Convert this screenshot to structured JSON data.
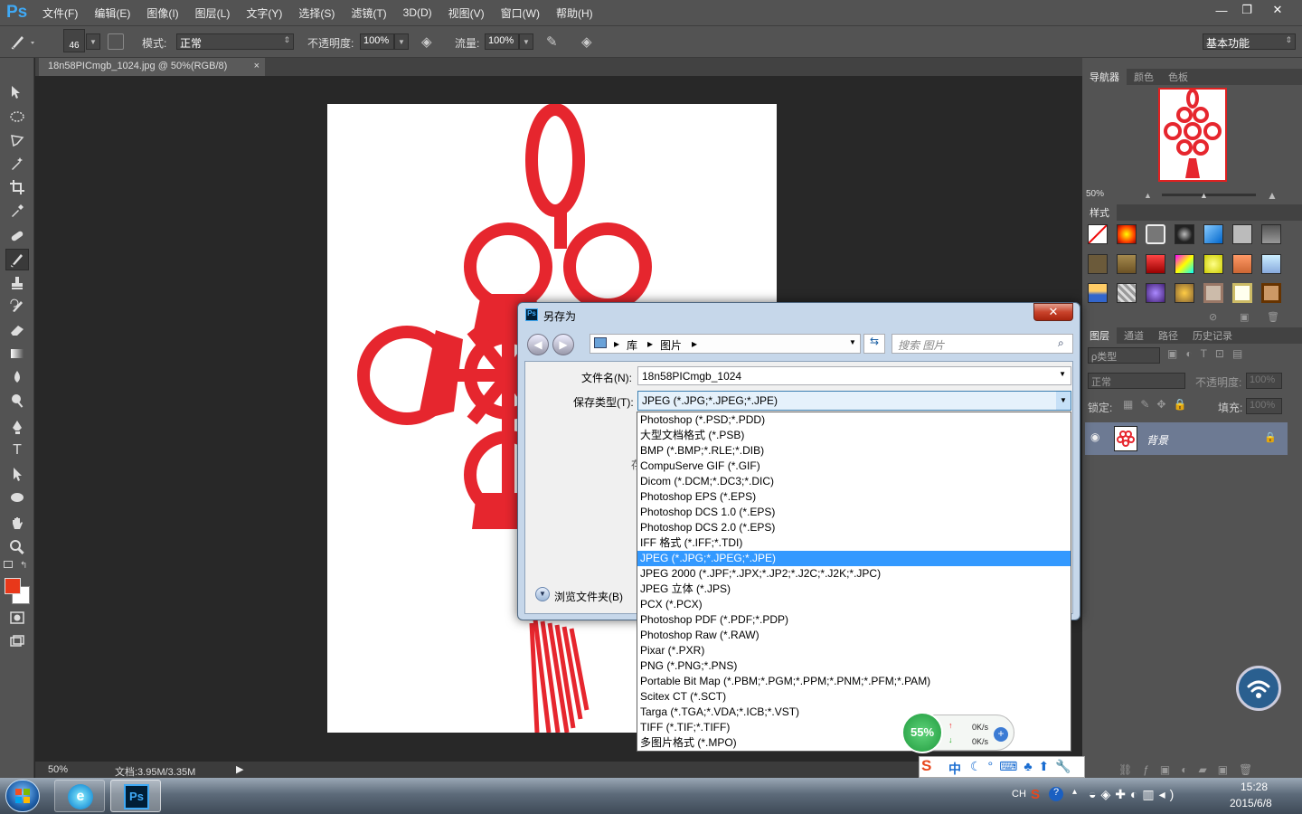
{
  "app": {
    "logo": "Ps",
    "menus": [
      "文件(F)",
      "编辑(E)",
      "图像(I)",
      "图层(L)",
      "文字(Y)",
      "选择(S)",
      "滤镜(T)",
      "3D(D)",
      "视图(V)",
      "窗口(W)",
      "帮助(H)"
    ],
    "window_buttons": [
      "—",
      "❐",
      "✕"
    ]
  },
  "options": {
    "brush_size": "46",
    "mode_label": "模式:",
    "mode_value": "正常",
    "opacity_label": "不透明度:",
    "opacity_value": "100%",
    "flow_label": "流量:",
    "flow_value": "100%",
    "workspace": "基本功能"
  },
  "document": {
    "tab_title": "18n58PICmgb_1024.jpg @ 50%(RGB/8)",
    "tab_close": "×"
  },
  "status": {
    "zoom": "50%",
    "doc_info": "文档:3.95M/3.35M"
  },
  "navigator": {
    "tabs": [
      "导航器",
      "颜色",
      "色板"
    ],
    "zoom": "50%"
  },
  "styles": {
    "title": "样式"
  },
  "layers": {
    "tabs": [
      "图层",
      "通道",
      "路径",
      "历史记录"
    ],
    "kind": "ρ类型",
    "blend": "正常",
    "opacity_label": "不透明度:",
    "opacity_value": "100%",
    "lock_label": "锁定:",
    "fill_label": "填充:",
    "fill_value": "100%",
    "layer_name": "背景"
  },
  "dialog": {
    "title": "另存为",
    "breadcrumb": [
      "库",
      "图片"
    ],
    "search_placeholder": "搜索 图片",
    "filename_label": "文件名(N):",
    "filename_value": "18n58PICmgb_1024",
    "type_label": "保存类型(T):",
    "type_value": "JPEG (*.JPG;*.JPEG;*.JPE)",
    "browse_label": "浏览文件夹(B)",
    "stub": "存"
  },
  "file_types": [
    "Photoshop (*.PSD;*.PDD)",
    "大型文档格式 (*.PSB)",
    "BMP (*.BMP;*.RLE;*.DIB)",
    "CompuServe GIF (*.GIF)",
    "Dicom (*.DCM;*.DC3;*.DIC)",
    "Photoshop EPS (*.EPS)",
    "Photoshop DCS 1.0 (*.EPS)",
    "Photoshop DCS 2.0 (*.EPS)",
    "IFF 格式 (*.IFF;*.TDI)",
    "JPEG (*.JPG;*.JPEG;*.JPE)",
    "JPEG 2000 (*.JPF;*.JPX;*.JP2;*.J2C;*.J2K;*.JPC)",
    "JPEG 立体 (*.JPS)",
    "PCX (*.PCX)",
    "Photoshop PDF (*.PDF;*.PDP)",
    "Photoshop Raw (*.RAW)",
    "Pixar (*.PXR)",
    "PNG (*.PNG;*.PNS)",
    "Portable Bit Map (*.PBM;*.PGM;*.PPM;*.PNM;*.PFM;*.PAM)",
    "Scitex CT (*.SCT)",
    "Targa (*.TGA;*.VDA;*.ICB;*.VST)",
    "TIFF (*.TIF;*.TIFF)",
    "多图片格式 (*.MPO)"
  ],
  "selected_type_index": 9,
  "netmeter": {
    "percent": "55%",
    "up": "0K/s",
    "down": "0K/s"
  },
  "ime": {
    "lang": "中"
  },
  "taskbar": {
    "lang": "CH",
    "time": "15:28",
    "date": "2015/6/8"
  }
}
